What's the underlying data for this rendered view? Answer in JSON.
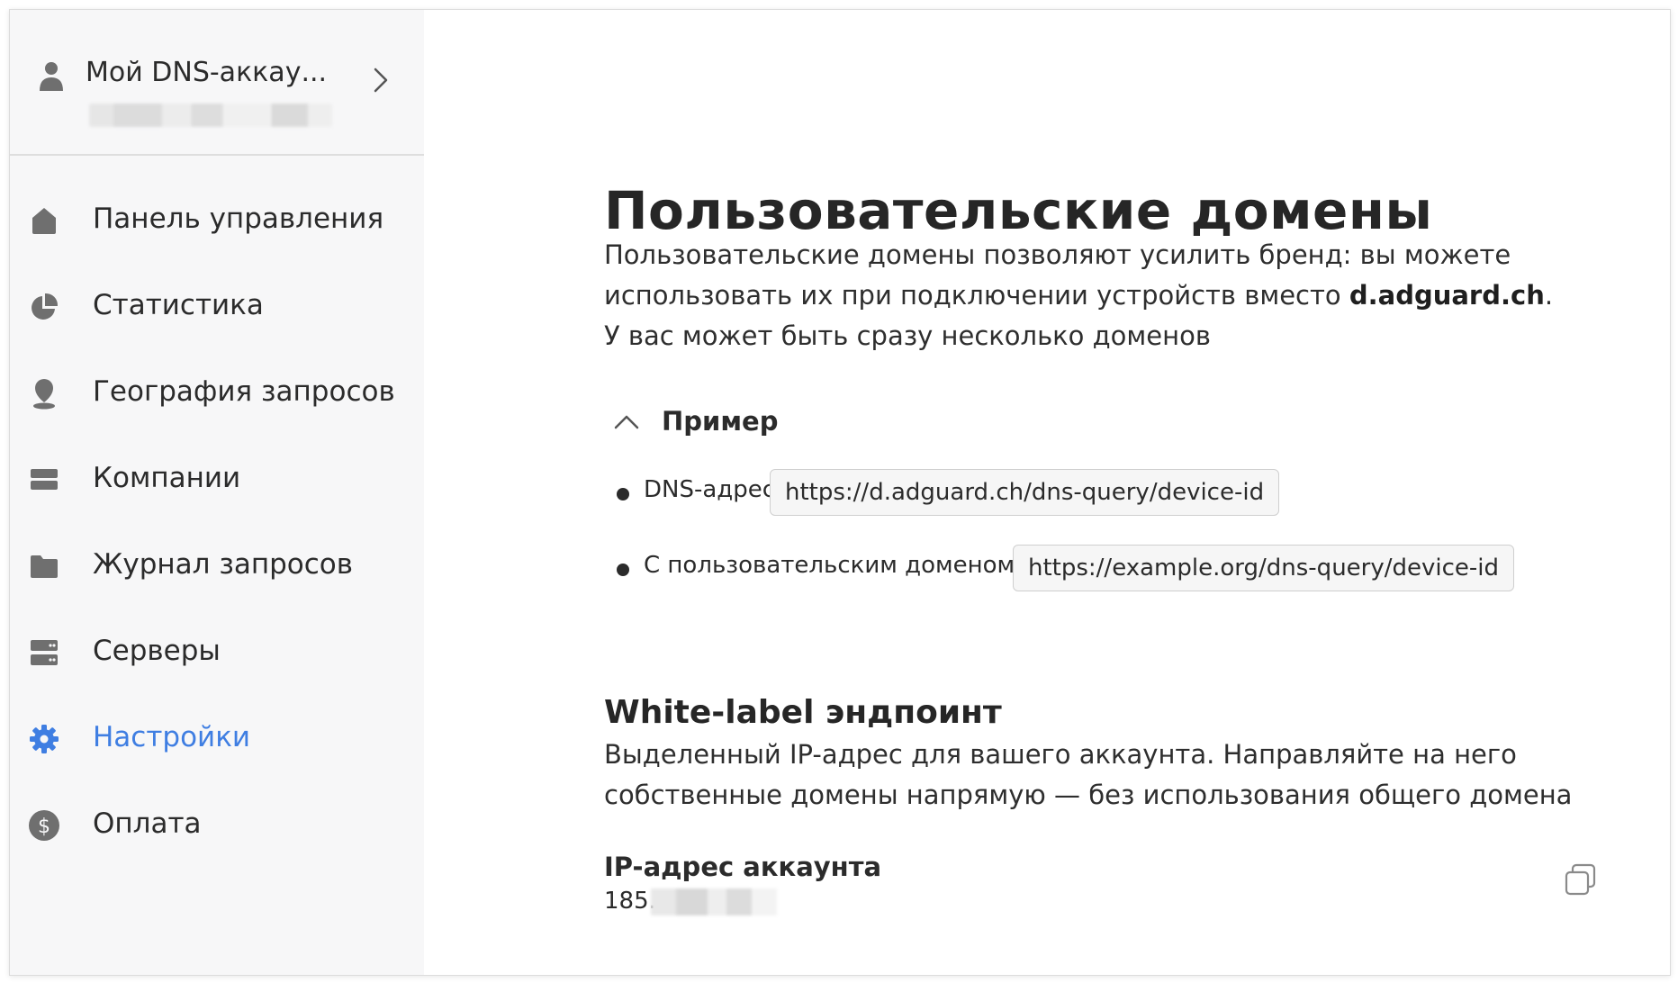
{
  "account": {
    "name": "Мой DNS-аккау..."
  },
  "sidebar": {
    "items": [
      {
        "label": "Панель управления",
        "icon": "home-icon"
      },
      {
        "label": "Статистика",
        "icon": "pie-chart-icon"
      },
      {
        "label": "География запросов",
        "icon": "location-pin-icon"
      },
      {
        "label": "Компании",
        "icon": "companies-icon"
      },
      {
        "label": "Журнал запросов",
        "icon": "folder-icon"
      },
      {
        "label": "Серверы",
        "icon": "servers-icon"
      },
      {
        "label": "Настройки",
        "icon": "gear-icon",
        "active": true
      },
      {
        "label": "Оплата",
        "icon": "dollar-icon"
      }
    ]
  },
  "main": {
    "title": "Пользовательские домены",
    "description_part1": "Пользовательские домены позволяют усилить бренд: вы можете использовать их при подключении устройств вместо ",
    "description_bold": "d.adguard.ch",
    "description_part2": ".",
    "description_line3": "У вас может быть сразу несколько доменов",
    "example": {
      "label": "Пример",
      "rows": [
        {
          "key": "DNS-адрес:",
          "value": "https://d.adguard.ch/dns-query/device-id"
        },
        {
          "key": "С пользовательским доменом:",
          "value": "https://example.org/dns-query/device-id"
        }
      ]
    },
    "white_label": {
      "title": "White-label эндпоинт",
      "description": "Выделенный IP-адрес для вашего аккаунта. Направляйте на него собственные домены напрямую — без использования общего домена",
      "ip_label": "IP-адрес аккаунта",
      "ip_value_visible": "185."
    }
  },
  "colors": {
    "accent": "#3f7ee2",
    "sidebar_bg": "#f7f7f8",
    "icon_gray": "#6f6f6f",
    "text": "#2b2b2b"
  }
}
